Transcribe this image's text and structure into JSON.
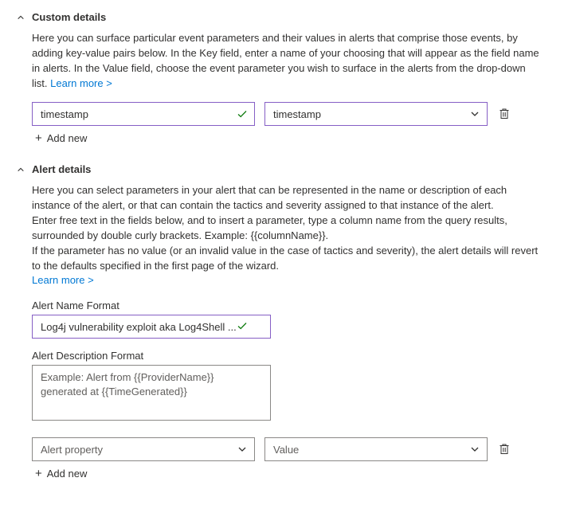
{
  "sections": {
    "custom_details": {
      "title": "Custom details",
      "description": "Here you can surface particular event parameters and their values in alerts that comprise those events, by adding key-value pairs below. In the Key field, enter a name of your choosing that will appear as the field name in alerts. In the Value field, choose the event parameter you wish to surface in the alerts from the drop-down list.",
      "learn_more": "Learn more >",
      "key_value": "timestamp",
      "value_value": "timestamp",
      "add_new": "Add new"
    },
    "alert_details": {
      "title": "Alert details",
      "description_p1": "Here you can select parameters in your alert that can be represented in the name or description of each instance of the alert, or that can contain the tactics and severity assigned to that instance of the alert.",
      "description_p2": "Enter free text in the fields below, and to insert a parameter, type a column name from the query results, surrounded by double curly brackets. Example: {{columnName}}.",
      "description_p3": "If the parameter has no value (or an invalid value in the case of tactics and severity), the alert details will revert to the defaults specified in the first page of the wizard.",
      "learn_more": "Learn more >",
      "alert_name_label": "Alert Name Format",
      "alert_name_value": "Log4j vulnerability exploit aka Log4Shell ...",
      "alert_desc_label": "Alert Description Format",
      "alert_desc_placeholder": "Example: Alert from {{ProviderName}} generated at {{TimeGenerated}}",
      "property_placeholder": "Alert property",
      "value_placeholder": "Value",
      "add_new": "Add new"
    }
  }
}
